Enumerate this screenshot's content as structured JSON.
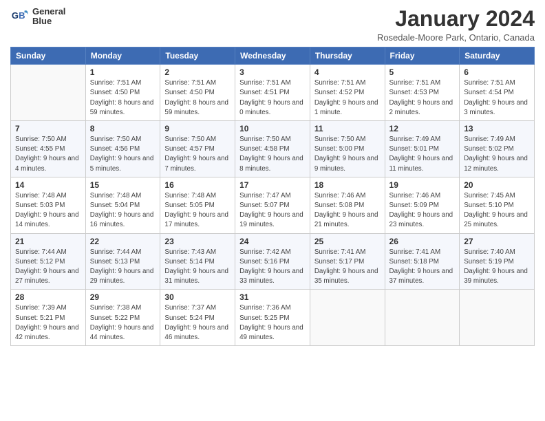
{
  "logo": {
    "line1": "General",
    "line2": "Blue"
  },
  "title": "January 2024",
  "subtitle": "Rosedale-Moore Park, Ontario, Canada",
  "weekdays": [
    "Sunday",
    "Monday",
    "Tuesday",
    "Wednesday",
    "Thursday",
    "Friday",
    "Saturday"
  ],
  "weeks": [
    [
      {
        "day": "",
        "sunrise": "",
        "sunset": "",
        "daylight": ""
      },
      {
        "day": "1",
        "sunrise": "Sunrise: 7:51 AM",
        "sunset": "Sunset: 4:50 PM",
        "daylight": "Daylight: 8 hours and 59 minutes."
      },
      {
        "day": "2",
        "sunrise": "Sunrise: 7:51 AM",
        "sunset": "Sunset: 4:50 PM",
        "daylight": "Daylight: 8 hours and 59 minutes."
      },
      {
        "day": "3",
        "sunrise": "Sunrise: 7:51 AM",
        "sunset": "Sunset: 4:51 PM",
        "daylight": "Daylight: 9 hours and 0 minutes."
      },
      {
        "day": "4",
        "sunrise": "Sunrise: 7:51 AM",
        "sunset": "Sunset: 4:52 PM",
        "daylight": "Daylight: 9 hours and 1 minute."
      },
      {
        "day": "5",
        "sunrise": "Sunrise: 7:51 AM",
        "sunset": "Sunset: 4:53 PM",
        "daylight": "Daylight: 9 hours and 2 minutes."
      },
      {
        "day": "6",
        "sunrise": "Sunrise: 7:51 AM",
        "sunset": "Sunset: 4:54 PM",
        "daylight": "Daylight: 9 hours and 3 minutes."
      }
    ],
    [
      {
        "day": "7",
        "sunrise": "Sunrise: 7:50 AM",
        "sunset": "Sunset: 4:55 PM",
        "daylight": "Daylight: 9 hours and 4 minutes."
      },
      {
        "day": "8",
        "sunrise": "Sunrise: 7:50 AM",
        "sunset": "Sunset: 4:56 PM",
        "daylight": "Daylight: 9 hours and 5 minutes."
      },
      {
        "day": "9",
        "sunrise": "Sunrise: 7:50 AM",
        "sunset": "Sunset: 4:57 PM",
        "daylight": "Daylight: 9 hours and 7 minutes."
      },
      {
        "day": "10",
        "sunrise": "Sunrise: 7:50 AM",
        "sunset": "Sunset: 4:58 PM",
        "daylight": "Daylight: 9 hours and 8 minutes."
      },
      {
        "day": "11",
        "sunrise": "Sunrise: 7:50 AM",
        "sunset": "Sunset: 5:00 PM",
        "daylight": "Daylight: 9 hours and 9 minutes."
      },
      {
        "day": "12",
        "sunrise": "Sunrise: 7:49 AM",
        "sunset": "Sunset: 5:01 PM",
        "daylight": "Daylight: 9 hours and 11 minutes."
      },
      {
        "day": "13",
        "sunrise": "Sunrise: 7:49 AM",
        "sunset": "Sunset: 5:02 PM",
        "daylight": "Daylight: 9 hours and 12 minutes."
      }
    ],
    [
      {
        "day": "14",
        "sunrise": "Sunrise: 7:48 AM",
        "sunset": "Sunset: 5:03 PM",
        "daylight": "Daylight: 9 hours and 14 minutes."
      },
      {
        "day": "15",
        "sunrise": "Sunrise: 7:48 AM",
        "sunset": "Sunset: 5:04 PM",
        "daylight": "Daylight: 9 hours and 16 minutes."
      },
      {
        "day": "16",
        "sunrise": "Sunrise: 7:48 AM",
        "sunset": "Sunset: 5:05 PM",
        "daylight": "Daylight: 9 hours and 17 minutes."
      },
      {
        "day": "17",
        "sunrise": "Sunrise: 7:47 AM",
        "sunset": "Sunset: 5:07 PM",
        "daylight": "Daylight: 9 hours and 19 minutes."
      },
      {
        "day": "18",
        "sunrise": "Sunrise: 7:46 AM",
        "sunset": "Sunset: 5:08 PM",
        "daylight": "Daylight: 9 hours and 21 minutes."
      },
      {
        "day": "19",
        "sunrise": "Sunrise: 7:46 AM",
        "sunset": "Sunset: 5:09 PM",
        "daylight": "Daylight: 9 hours and 23 minutes."
      },
      {
        "day": "20",
        "sunrise": "Sunrise: 7:45 AM",
        "sunset": "Sunset: 5:10 PM",
        "daylight": "Daylight: 9 hours and 25 minutes."
      }
    ],
    [
      {
        "day": "21",
        "sunrise": "Sunrise: 7:44 AM",
        "sunset": "Sunset: 5:12 PM",
        "daylight": "Daylight: 9 hours and 27 minutes."
      },
      {
        "day": "22",
        "sunrise": "Sunrise: 7:44 AM",
        "sunset": "Sunset: 5:13 PM",
        "daylight": "Daylight: 9 hours and 29 minutes."
      },
      {
        "day": "23",
        "sunrise": "Sunrise: 7:43 AM",
        "sunset": "Sunset: 5:14 PM",
        "daylight": "Daylight: 9 hours and 31 minutes."
      },
      {
        "day": "24",
        "sunrise": "Sunrise: 7:42 AM",
        "sunset": "Sunset: 5:16 PM",
        "daylight": "Daylight: 9 hours and 33 minutes."
      },
      {
        "day": "25",
        "sunrise": "Sunrise: 7:41 AM",
        "sunset": "Sunset: 5:17 PM",
        "daylight": "Daylight: 9 hours and 35 minutes."
      },
      {
        "day": "26",
        "sunrise": "Sunrise: 7:41 AM",
        "sunset": "Sunset: 5:18 PM",
        "daylight": "Daylight: 9 hours and 37 minutes."
      },
      {
        "day": "27",
        "sunrise": "Sunrise: 7:40 AM",
        "sunset": "Sunset: 5:19 PM",
        "daylight": "Daylight: 9 hours and 39 minutes."
      }
    ],
    [
      {
        "day": "28",
        "sunrise": "Sunrise: 7:39 AM",
        "sunset": "Sunset: 5:21 PM",
        "daylight": "Daylight: 9 hours and 42 minutes."
      },
      {
        "day": "29",
        "sunrise": "Sunrise: 7:38 AM",
        "sunset": "Sunset: 5:22 PM",
        "daylight": "Daylight: 9 hours and 44 minutes."
      },
      {
        "day": "30",
        "sunrise": "Sunrise: 7:37 AM",
        "sunset": "Sunset: 5:24 PM",
        "daylight": "Daylight: 9 hours and 46 minutes."
      },
      {
        "day": "31",
        "sunrise": "Sunrise: 7:36 AM",
        "sunset": "Sunset: 5:25 PM",
        "daylight": "Daylight: 9 hours and 49 minutes."
      },
      {
        "day": "",
        "sunrise": "",
        "sunset": "",
        "daylight": ""
      },
      {
        "day": "",
        "sunrise": "",
        "sunset": "",
        "daylight": ""
      },
      {
        "day": "",
        "sunrise": "",
        "sunset": "",
        "daylight": ""
      }
    ]
  ]
}
